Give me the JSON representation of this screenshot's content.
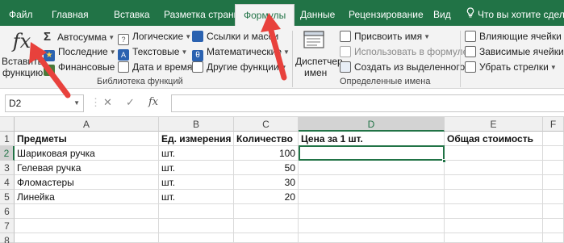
{
  "tabs": [
    "Файл",
    "Главная",
    "Вставка",
    "Разметка страницы",
    "Формулы",
    "Данные",
    "Рецензирование",
    "Вид"
  ],
  "active_tab": "Формулы",
  "tell_me": "Что вы хотите сделать",
  "ribbon": {
    "insert_function": {
      "line1": "Вставить",
      "line2": "функцию",
      "glyph": "fx"
    },
    "library": {
      "autosum": "Автосумма",
      "recent": "Последние",
      "financial": "Финансовые",
      "logical": "Логические",
      "text": "Текстовые",
      "datetime": "Дата и время",
      "lookup": "Ссылки и масси",
      "math": "Математические",
      "other": "Другие функции",
      "group_label": "Библиотека функций"
    },
    "names": {
      "manager_line1": "Диспетчер",
      "manager_line2": "имен",
      "define_name": "Присвоить имя",
      "use_in_formula": "Использовать в формуле",
      "create_from_selection": "Создать из выделенного",
      "group_label": "Определенные имена"
    },
    "audit": {
      "trace_precedents": "Влияющие ячейки",
      "trace_dependents": "Зависимые ячейки",
      "remove_arrows": "Убрать стрелки"
    }
  },
  "formula_bar": {
    "name_box": "D2",
    "cancel": "✕",
    "enter": "✓",
    "fx": "fx",
    "value": ""
  },
  "grid": {
    "columns": [
      "A",
      "B",
      "C",
      "D",
      "E",
      "F"
    ],
    "selected_column": "D",
    "rows": [
      "1",
      "2",
      "3",
      "4",
      "5",
      "6",
      "7",
      "8"
    ],
    "selected_row": "2",
    "cells": {
      "A1": "Предметы",
      "B1": "Ед. измерения",
      "C1": "Количество",
      "D1": "Цена за 1 шт.",
      "E1": "Общая стоимость",
      "A2": "Шариковая ручка",
      "B2": "шт.",
      "C2": "100",
      "A3": "Гелевая ручка",
      "B3": "шт.",
      "C3": "50",
      "A4": "Фломастеры",
      "B4": "шт.",
      "C4": "30",
      "A5": "Линейка",
      "B5": "шт.",
      "C5": "20"
    },
    "active_cell": "D2"
  },
  "colors": {
    "excel_green": "#217346",
    "arrow_red": "#e8413c"
  }
}
